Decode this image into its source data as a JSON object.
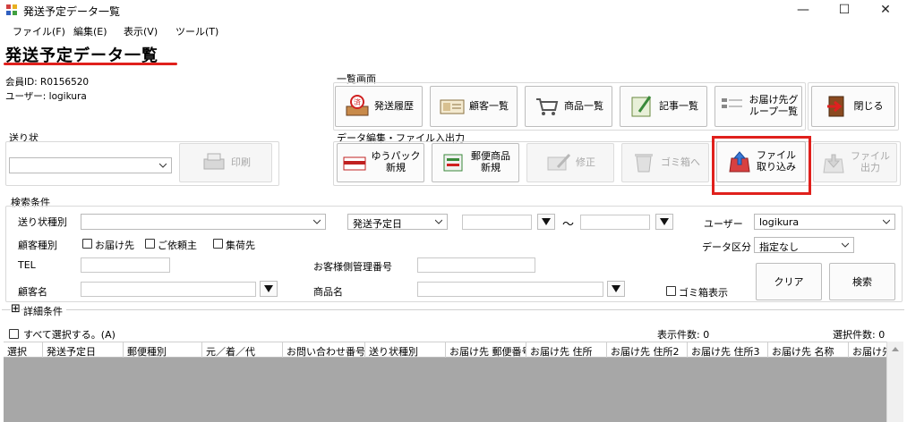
{
  "window": {
    "title": "発送予定データ一覧",
    "minimize": "—",
    "maximize": "☐",
    "close": "✕"
  },
  "menu": [
    "ファイル(F)",
    "編集(E)",
    "表示(V)",
    "ツール(T)"
  ],
  "page_title": "発送予定データ一覧",
  "member": {
    "id_text": "会員ID: R0156520",
    "user_text": "ユーザー: logikura"
  },
  "list_screen": {
    "label": "一覧画面",
    "buttons": [
      "発送履歴",
      "顧客一覧",
      "商品一覧",
      "記事一覧",
      "お届け先グ\nループ一覧",
      "閉じる"
    ]
  },
  "invoice": {
    "label": "送り状",
    "select_value": "",
    "print_label": "印刷"
  },
  "data_edit": {
    "label": "データ編集・ファイル入出力",
    "buttons": [
      "ゆうパック\n新規",
      "郵便商品\n新規",
      "修正",
      "ゴミ箱へ",
      "ファイル\n取り込み",
      "ファイル\n出力"
    ]
  },
  "search": {
    "label": "検索条件",
    "invoice_type_label": "送り状種別",
    "invoice_type_value": "",
    "date_field_value": "発送予定日",
    "date_from": "",
    "date_to": "",
    "tilde": "〜",
    "user_label": "ユーザー",
    "user_value": "logikura",
    "customer_type_label": "顧客種別",
    "check_delivery": "お届け先",
    "check_requester": "ご依頼主",
    "check_shipper": "集荷先",
    "data_division_label": "データ区分",
    "data_division_value": "指定なし",
    "tel_label": "TEL",
    "tel_value": "",
    "customer_mgmt_label": "お客様側管理番号",
    "customer_mgmt_value": "",
    "customer_name_label": "顧客名",
    "customer_name_value": "",
    "product_name_label": "商品名",
    "product_name_value": "",
    "trash_display": "ゴミ箱表示",
    "clear_button": "クリア",
    "search_button": "検索"
  },
  "details": {
    "toggle": "⊞",
    "label": "詳細条件"
  },
  "results": {
    "select_all": "すべて選択する。(A)",
    "display_count": "表示件数: 0",
    "selected_count": "選択件数: 0",
    "columns": [
      "選択",
      "発送予定日",
      "郵便種別",
      "元／着／代",
      "お問い合わせ番号",
      "送り状種別",
      "お届け先 郵便番号",
      "お届け先 住所",
      "お届け先 住所2",
      "お届け先 住所3",
      "お届け先 名称",
      "お届け先"
    ]
  },
  "colors": {
    "accent_red": "#e0201c",
    "grid_empty": "#a7a7a7"
  },
  "icons": {
    "list_screen": [
      "shipping-history-icon",
      "customer-list-icon",
      "product-cart-icon",
      "article-notebook-icon",
      "delivery-group-icon",
      "exit-door-icon"
    ],
    "data_edit": [
      "yu-pack-box-icon",
      "postal-product-icon",
      "edit-pencil-icon",
      "trash-icon",
      "file-import-icon",
      "file-export-icon"
    ]
  }
}
